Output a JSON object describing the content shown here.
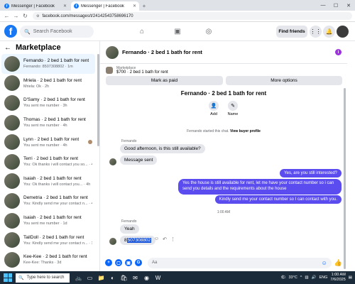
{
  "browser": {
    "tabs": [
      {
        "title": "Messenger | Facebook",
        "active": false
      },
      {
        "title": "Messenger | Facebook",
        "active": true
      }
    ],
    "url": "facebook.com/messages/t/24142543758696170"
  },
  "header": {
    "logo": "f",
    "search_placeholder": "Search Facebook",
    "find_friends": "Find friends"
  },
  "sidebar": {
    "title": "Marketplace",
    "conversations": [
      {
        "name": "Fernando · 2 bed 1 bath for rent",
        "preview": "Fernando: 8507308802 · 1m",
        "selected": true
      },
      {
        "name": "Mriela · 2 bed 1 bath for rent",
        "preview": "Mriela: Ok · 2h"
      },
      {
        "name": "D'Samy · 2 bed 1 bath for rent",
        "preview": "You sent me number · 3h"
      },
      {
        "name": "Thomas · 2 bed 1 bath for rent",
        "preview": "You sent me number · 4h"
      },
      {
        "name": "Lynn · 2 bed 1 bath for rent",
        "preview": "You sent me number · 4h"
      },
      {
        "name": "Terri · 2 bed 1 bath for rent",
        "preview": "You: Ok thanks i will contact you so... · 4h"
      },
      {
        "name": "Isaiah · 2 bed 1 bath for rent",
        "preview": "You: Ok thanks i will contact you... · 4h"
      },
      {
        "name": "Demetria · 2 bed 1 bath for rent",
        "preview": "You: Kindly send me your contact n... · 4h"
      },
      {
        "name": "Isaiah · 2 bed 1 bath for rent",
        "preview": "You sent me number · 1d"
      },
      {
        "name": "TailDoll · 2 bed 1 bath for rent",
        "preview": "You: Kindly send me your contact n... · 1d"
      },
      {
        "name": "Kee-Kee · 2 bed 1 bath for rent",
        "preview": "Kee-Kee: Thanks · 3d"
      }
    ]
  },
  "chat": {
    "title": "Fernando · 2 bed 1 bath for rent",
    "listing_label": "Marketplace",
    "listing_value": "$700 · 2 bed 1 bath for rent",
    "mark_paid": "Mark as paid",
    "more_options": "More options",
    "convo_title": "Fernando · 2 bed 1 bath for rent",
    "add_label": "Add",
    "name_label": "Name",
    "started_prefix": "Fernando started this chat.",
    "started_link": "View buyer profile",
    "sender_name": "Fernando",
    "messages_in_1": [
      "Good afternoon, is this still available?",
      "Message sent"
    ],
    "out_1": "Yes, are you still interested?",
    "out_2": "Yes the house is still available for rent, let me have your contact number so i can send you details and the requirements about the house",
    "out_3": "Kindly send me your contact number so I can contact with you.",
    "time_sep": "1:00 AM",
    "sender_name_2": "Fernando",
    "in_2": "Yeah",
    "in_3_prefix": "8",
    "in_3_selected": "507308802",
    "composer_placeholder": "Aa"
  },
  "taskbar": {
    "search_placeholder": "Type here to search",
    "temp": "33°C",
    "lang": "ENG",
    "time": "1:00 AM",
    "date": "7/6/2025"
  },
  "colors": {
    "fb_blue": "#1877f2",
    "outgoing_bubble": "#5b4cf0",
    "selected_conv": "#ebf5ff"
  }
}
